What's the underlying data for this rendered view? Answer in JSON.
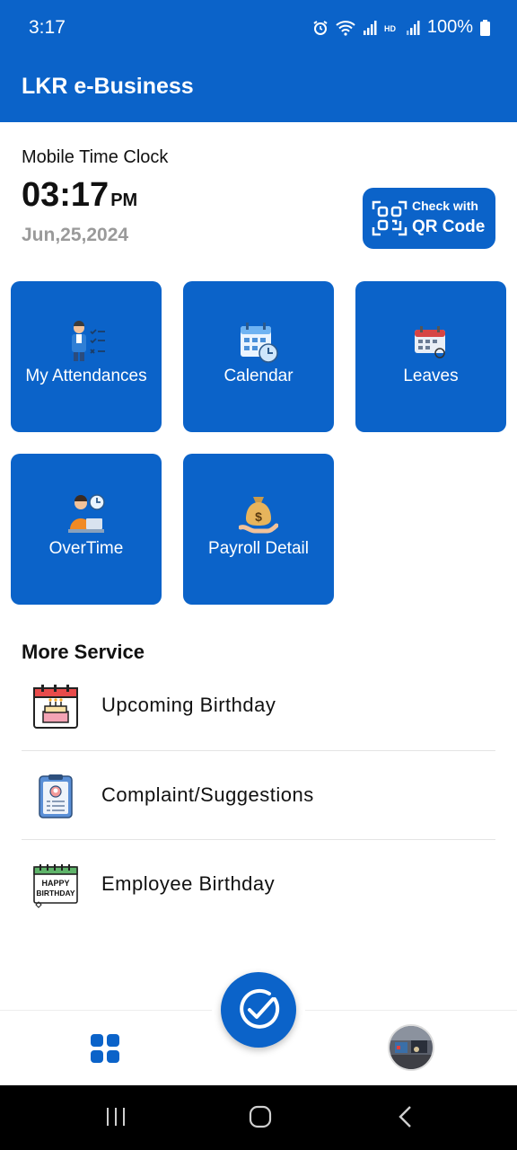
{
  "status_bar": {
    "time": "3:17",
    "battery": "100%",
    "icons": [
      "alarm-icon",
      "wifi-icon",
      "signal-icon",
      "hd-icon",
      "signal-icon",
      "battery-icon"
    ]
  },
  "app_bar": {
    "title": "LKR e-Business"
  },
  "clock": {
    "label": "Mobile Time Clock",
    "time": "03:17",
    "ampm": "PM",
    "date": "Jun,25,2024"
  },
  "qr_button": {
    "line1": "Check with",
    "line2": "QR Code",
    "icon": "qr-code-icon"
  },
  "tiles": [
    {
      "label": "My Attendances",
      "icon": "attendance-icon"
    },
    {
      "label": "Calendar",
      "icon": "calendar-icon"
    },
    {
      "label": "Leaves",
      "icon": "leave-calendar-icon"
    },
    {
      "label": "OverTime",
      "icon": "overtime-icon"
    },
    {
      "label": "Payroll Detail",
      "icon": "money-bag-icon"
    }
  ],
  "more_service": {
    "title": "More Service",
    "items": [
      {
        "label": "Upcoming Birthday",
        "icon": "birthday-cake-icon"
      },
      {
        "label": "Complaint/Suggestions",
        "icon": "clipboard-icon"
      },
      {
        "label": "Employee Birthday",
        "icon": "happy-birthday-icon",
        "icon_text_1": "HAPPY",
        "icon_text_2": "BIRTHDAY"
      }
    ]
  },
  "bottom_nav": {
    "home_icon": "grid-icon",
    "fab_icon": "check-circle-icon",
    "avatar": "profile-avatar"
  },
  "colors": {
    "primary": "#0b63c9",
    "date_gray": "#9a9a9a"
  }
}
